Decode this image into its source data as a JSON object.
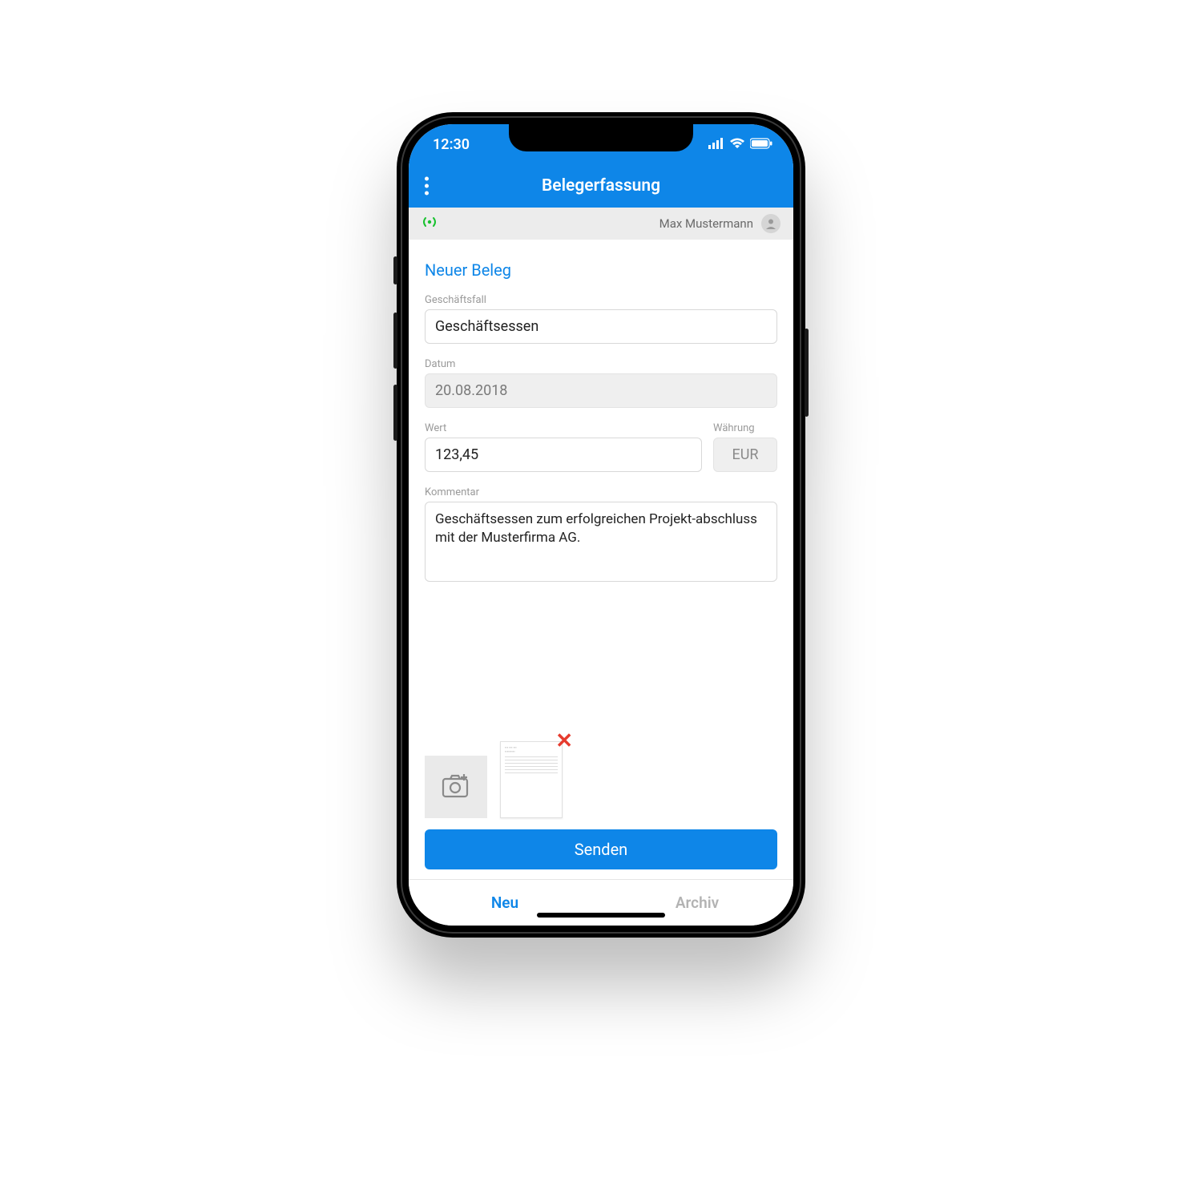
{
  "status": {
    "time": "12:30"
  },
  "header": {
    "title": "Belegerfassung"
  },
  "user": {
    "name": "Max Mustermann"
  },
  "form": {
    "section_title": "Neuer Beleg",
    "business_case": {
      "label": "Geschäftsfall",
      "value": "Geschäftsessen"
    },
    "date": {
      "label": "Datum",
      "value": "20.08.2018"
    },
    "amount": {
      "label": "Wert",
      "value": "123,45"
    },
    "currency": {
      "label": "Währung",
      "value": "EUR"
    },
    "comment": {
      "label": "Kommentar",
      "value": "Geschäftsessen zum erfolgreichen Projekt-abschluss mit der Musterfirma AG."
    }
  },
  "actions": {
    "send": "Senden"
  },
  "tabs": {
    "new": "Neu",
    "archive": "Archiv"
  }
}
